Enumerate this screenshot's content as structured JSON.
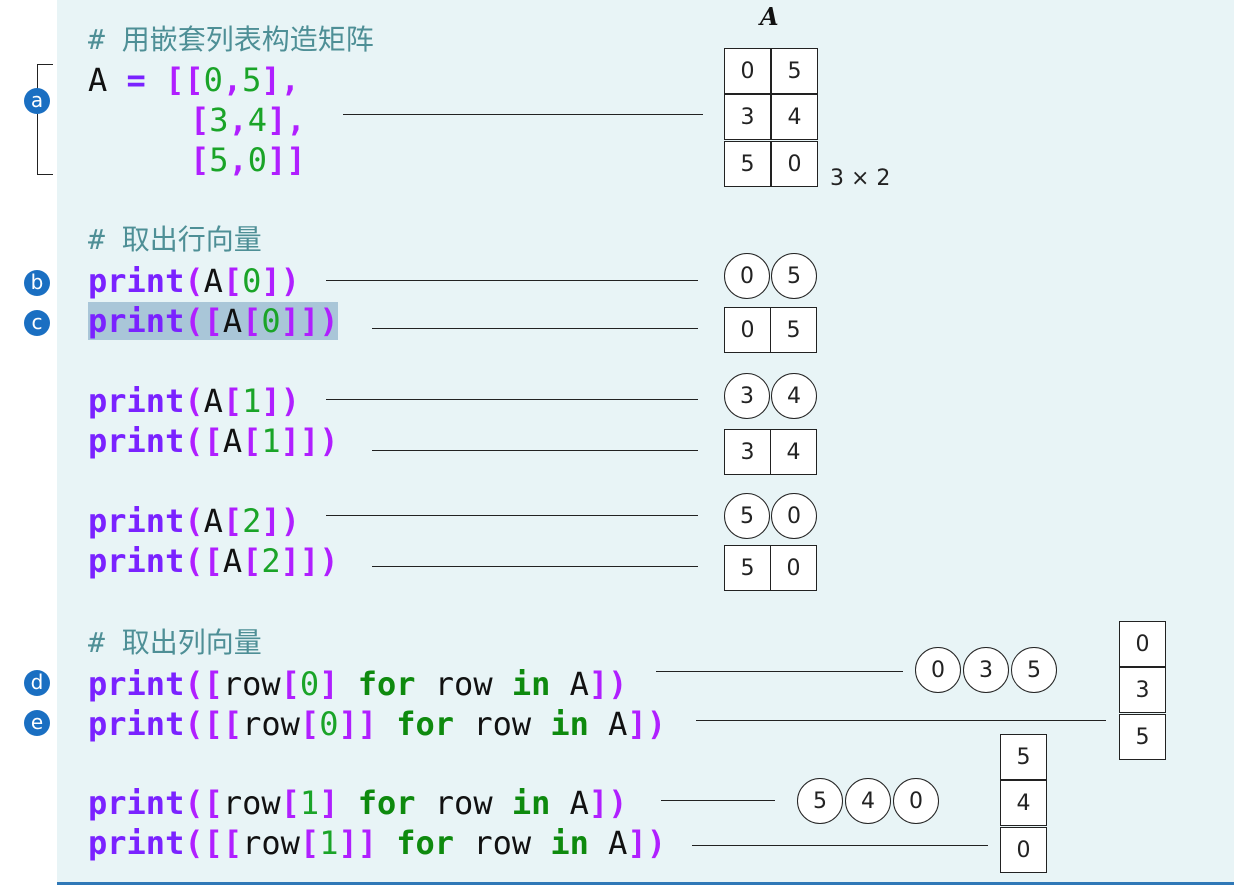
{
  "comments": {
    "build": "# 用嵌套列表构造矩阵",
    "rows": "# 取出行向量",
    "cols": "# 取出列向量"
  },
  "code": {
    "a_line1": [
      "A",
      " = ",
      "[[",
      "0",
      ",",
      "5",
      "],"
    ],
    "a_line2": [
      "[",
      "3",
      ",",
      "4",
      "],"
    ],
    "a_line3": [
      "[",
      "5",
      ",",
      "0",
      "]]"
    ],
    "b": [
      "print",
      "(",
      "A",
      "[",
      "0",
      "])"
    ],
    "c": [
      "print",
      "([",
      "A",
      "[",
      "0",
      "]])"
    ],
    "r1": [
      "print",
      "(",
      "A",
      "[",
      "1",
      "])"
    ],
    "r1b": [
      "print",
      "([",
      "A",
      "[",
      "1",
      "]])"
    ],
    "r2": [
      "print",
      "(",
      "A",
      "[",
      "2",
      "])"
    ],
    "r2b": [
      "print",
      "([",
      "A",
      "[",
      "2",
      "]])"
    ],
    "d": [
      "print",
      "([",
      "row",
      "[",
      "0",
      "] ",
      "for",
      " row ",
      "in",
      " A",
      "])"
    ],
    "e": [
      "print",
      "([[",
      "row",
      "[",
      "0",
      "]] ",
      "for",
      " row ",
      "in",
      " A",
      "])"
    ],
    "c1": [
      "print",
      "([",
      "row",
      "[",
      "1",
      "] ",
      "for",
      " row ",
      "in",
      " A",
      "])"
    ],
    "c1b": [
      "print",
      "([[",
      "row",
      "[",
      "1",
      "]] ",
      "for",
      " row ",
      "in",
      " A",
      "])"
    ]
  },
  "badges": [
    "a",
    "b",
    "c",
    "d",
    "e"
  ],
  "matrix": {
    "title": "A",
    "shape": "3 × 2",
    "cells": [
      [
        "0",
        "5"
      ],
      [
        "3",
        "4"
      ],
      [
        "5",
        "0"
      ]
    ]
  },
  "outputs": {
    "row0_vec": [
      "0",
      "5"
    ],
    "row0_mat": [
      "0",
      "5"
    ],
    "row1_vec": [
      "3",
      "4"
    ],
    "row1_mat": [
      "3",
      "4"
    ],
    "row2_vec": [
      "5",
      "0"
    ],
    "row2_mat": [
      "5",
      "0"
    ],
    "col0_vec": [
      "0",
      "3",
      "5"
    ],
    "col0_mat": [
      "0",
      "3",
      "5"
    ],
    "col1_vec": [
      "5",
      "4",
      "0"
    ],
    "col1_mat": [
      "5",
      "4",
      "0"
    ]
  },
  "colors": {
    "panel": "#e8f4f6",
    "badge": "#1a6fc2",
    "print": "#7a22ff",
    "bracket": "#b01fff",
    "number": "#1aa428",
    "keyword": "#0e8a0e",
    "highlight": "#a9c6d8"
  }
}
